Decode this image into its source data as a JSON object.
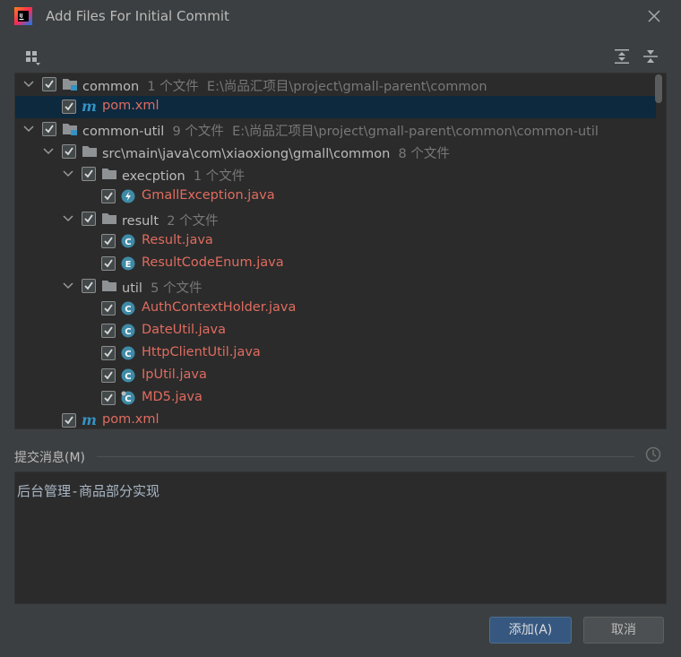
{
  "dialog": {
    "title": "Add Files For Initial Commit",
    "close_icon": "close-icon",
    "app_icon": "intellij-idea-icon"
  },
  "toolbar": {
    "group_icon": "group-by-icon",
    "expand_icon": "expand-all-icon",
    "collapse_icon": "collapse-all-icon"
  },
  "tree": {
    "rows": [
      {
        "name": "common",
        "meta": "1 个文件  E:\\尚品汇项目\\project\\gmall-parent\\common",
        "kind": "module",
        "expanded": true,
        "checked": true
      },
      {
        "name": "pom.xml",
        "meta": "",
        "kind": "maven",
        "checked": true,
        "selected": true
      },
      {
        "name": "common-util",
        "meta": "9 个文件  E:\\尚品汇项目\\project\\gmall-parent\\common\\common-util",
        "kind": "module",
        "expanded": true,
        "checked": true
      },
      {
        "name": "src\\main\\java\\com\\xiaoxiong\\gmall\\common",
        "meta": "8 个文件",
        "kind": "folder",
        "expanded": true,
        "checked": true
      },
      {
        "name": "execption",
        "meta": "1 个文件",
        "kind": "folder",
        "expanded": true,
        "checked": true
      },
      {
        "name": "GmallException.java",
        "meta": "",
        "kind": "exception",
        "checked": true
      },
      {
        "name": "result",
        "meta": "2 个文件",
        "kind": "folder",
        "expanded": true,
        "checked": true
      },
      {
        "name": "Result.java",
        "meta": "",
        "kind": "class",
        "checked": true
      },
      {
        "name": "ResultCodeEnum.java",
        "meta": "",
        "kind": "enum",
        "checked": true
      },
      {
        "name": "util",
        "meta": "5 个文件",
        "kind": "folder",
        "expanded": true,
        "checked": true
      },
      {
        "name": "AuthContextHolder.java",
        "meta": "",
        "kind": "class",
        "checked": true
      },
      {
        "name": "DateUtil.java",
        "meta": "",
        "kind": "class",
        "checked": true
      },
      {
        "name": "HttpClientUtil.java",
        "meta": "",
        "kind": "class",
        "checked": true
      },
      {
        "name": "IpUtil.java",
        "meta": "",
        "kind": "class",
        "checked": true
      },
      {
        "name": "MD5.java",
        "meta": "",
        "kind": "class-alt",
        "checked": true
      },
      {
        "name": "pom.xml",
        "meta": "",
        "kind": "maven",
        "checked": true
      }
    ]
  },
  "commit": {
    "label": "提交消息(M)",
    "message": "后台管理-商品部分实现",
    "history_icon": "clock-icon"
  },
  "buttons": {
    "add": "添加(A)",
    "cancel": "取消"
  },
  "colors": {
    "background": "#3c3f41",
    "panel": "#2b2b2b",
    "selection": "#0d293e",
    "new_file": "#e06c5f",
    "accent_button": "#365880"
  }
}
